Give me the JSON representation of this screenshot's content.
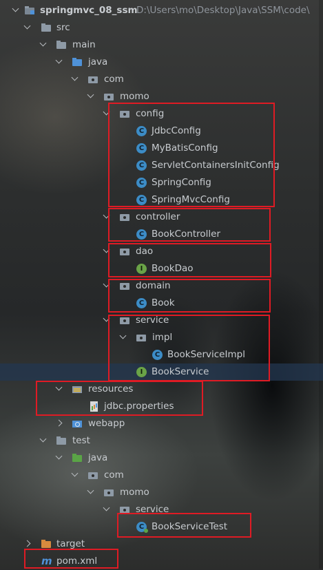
{
  "tree": {
    "project": {
      "name": "springmvc_08_ssm",
      "path": "D:\\Users\\mo\\Desktop\\Java\\SSM\\code\\"
    },
    "src": "src",
    "main": "main",
    "java_main": "java",
    "com_main": "com",
    "momo_main": "momo",
    "config": "config",
    "config_files": [
      "JdbcConfig",
      "MyBatisConfig",
      "ServletContainersInitConfig",
      "SpringConfig",
      "SpringMvcConfig"
    ],
    "controller": "controller",
    "book_controller": "BookController",
    "dao": "dao",
    "book_dao": "BookDao",
    "domain": "domain",
    "book": "Book",
    "service": "service",
    "impl": "impl",
    "book_service_impl": "BookServiceImpl",
    "book_service": "BookService",
    "resources": "resources",
    "jdbc_properties": "jdbc.properties",
    "webapp": "webapp",
    "test": "test",
    "java_test": "java",
    "com_test": "com",
    "momo_test": "momo",
    "service_test": "service",
    "book_service_test": "BookServiceTest",
    "target": "target",
    "pom": "pom.xml"
  },
  "icons": {
    "class": "C",
    "interface": "I",
    "maven": "m"
  },
  "colors": {
    "highlight_box": "#e01b24",
    "selection": "#233750"
  }
}
